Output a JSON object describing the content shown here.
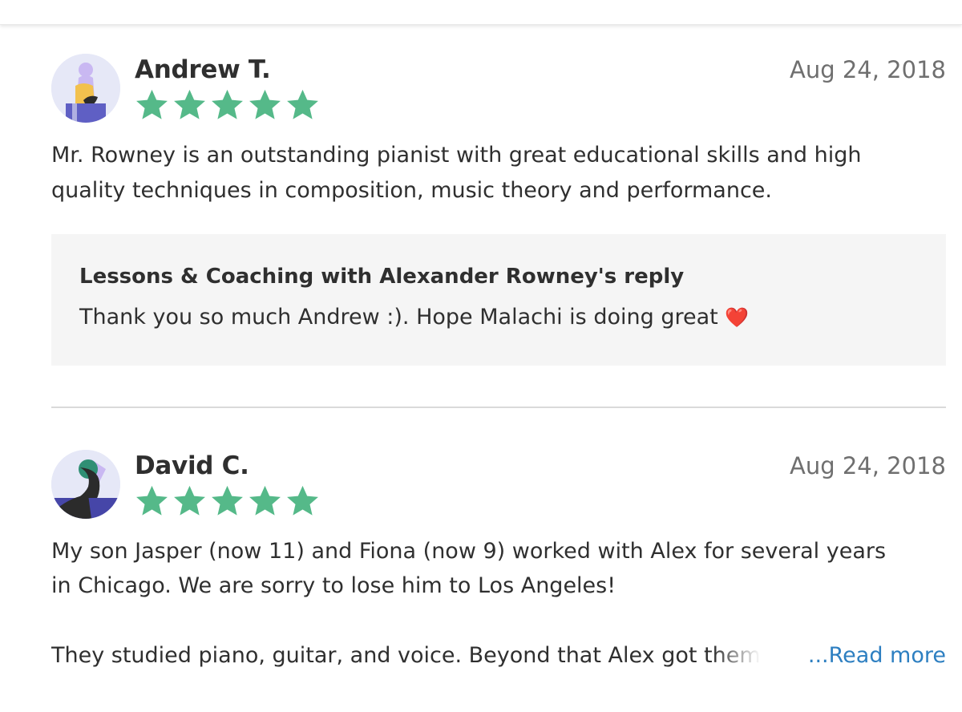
{
  "reviews": [
    {
      "name": "Andrew T.",
      "date": "Aug 24, 2018",
      "rating": 5,
      "body_lines": [
        "Mr. Rowney is an outstanding pianist with great educational skills and high",
        "quality techniques in composition, music theory and performance."
      ],
      "reply": {
        "title": "Lessons & Coaching with Alexander Rowney's reply",
        "text": "Thank you so much Andrew :). Hope Malachi is doing great",
        "emoji": "❤️"
      }
    },
    {
      "name": "David C.",
      "date": "Aug 24, 2018",
      "rating": 5,
      "body_lines": [
        "My son Jasper (now 11) and Fiona (now 9) worked with Alex for several years",
        "in Chicago. We are sorry to lose him to Los Angeles!"
      ],
      "body_truncated": "They studied piano, guitar, and voice. Beyond that Alex got them",
      "read_more": "...Read more"
    }
  ],
  "colors": {
    "star": "#55b989",
    "link": "#2d7fc1",
    "reply_bg": "#f5f5f5"
  }
}
